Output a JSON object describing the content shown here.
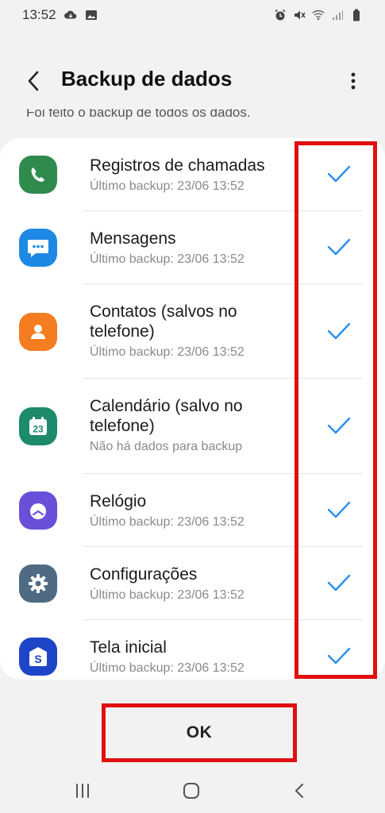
{
  "status_bar": {
    "time": "13:52"
  },
  "app_bar": {
    "title": "Backup de dados"
  },
  "subtitle": "Foi feito o backup de todos os dados.",
  "items": [
    {
      "title": "Registros de chamadas",
      "subtitle": "Último backup: 23/06 13:52",
      "icon": "phone-icon",
      "color": "#2f8a4e",
      "checked": true
    },
    {
      "title": "Mensagens",
      "subtitle": "Último backup: 23/06 13:52",
      "icon": "message-icon",
      "color": "#1e88e5",
      "checked": true
    },
    {
      "title": "Contatos (salvos no telefone)",
      "title_line1": "Contatos (salvos no",
      "title_line2": "telefone)",
      "subtitle": "Último backup: 23/06 13:52",
      "icon": "contact-icon",
      "color": "#f57c20",
      "checked": true
    },
    {
      "title": "Calendário (salvo no telefone)",
      "title_line1": "Calendário (salvo no",
      "title_line2": "telefone)",
      "subtitle": "Não há dados para backup",
      "icon": "calendar-icon",
      "icon_text": "23",
      "color": "#1d8a6b",
      "checked": true
    },
    {
      "title": "Relógio",
      "subtitle": "Último backup: 23/06 13:52",
      "icon": "clock-icon",
      "color": "#6a4fd8",
      "checked": true
    },
    {
      "title": "Configurações",
      "subtitle": "Último backup: 23/06 13:52",
      "icon": "gear-icon",
      "color": "#4f6b84",
      "checked": true
    },
    {
      "title": "Tela inicial",
      "subtitle": "Último backup: 23/06 13:52",
      "icon": "home-screen-icon",
      "color": "#1e45c8",
      "checked": true
    }
  ],
  "ok_label": "OK",
  "colors": {
    "check": "#2b8ef0",
    "highlight": "#e01010"
  }
}
